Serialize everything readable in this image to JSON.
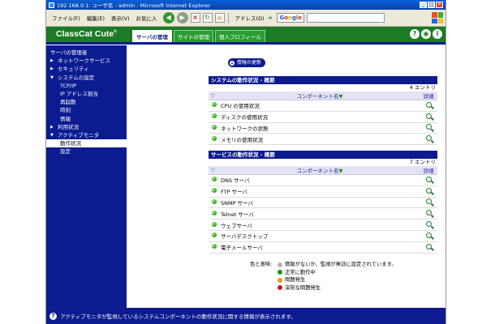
{
  "window": {
    "title": "192.168.0.1: ユーザ名 - admin - Microsoft Internet Explorer",
    "controls": [
      "minimize-icon",
      "maximize-icon",
      "close-icon"
    ]
  },
  "ie": {
    "menus": [
      "ファイル(F)",
      "編集(E)",
      "表示(V)",
      "お気に入"
    ],
    "address_label": "アドレス(D)",
    "search_brand": "Google",
    "search_value": ""
  },
  "header": {
    "logo": "ClassCat Cute",
    "logo_mark": "®",
    "tabs": [
      "サーバの管理",
      "サイトの管理",
      "個人プロフィール"
    ],
    "active_tab": 0,
    "icons": [
      "help-icon",
      "view-icon",
      "info-icon"
    ]
  },
  "sidebar": {
    "items": [
      {
        "label": "サーバの管理者",
        "level": 0,
        "arrow": false
      },
      {
        "label": "ネットワークサービス",
        "level": 0,
        "arrow": "right"
      },
      {
        "label": "セキュリティ",
        "level": 0,
        "arrow": "right"
      },
      {
        "label": "システムの設定",
        "level": 0,
        "arrow": "down"
      },
      {
        "label": "TCP/IP",
        "level": 1
      },
      {
        "label": "IP アドレス割当",
        "level": 1
      },
      {
        "label": "再起動",
        "level": 1
      },
      {
        "label": "時刻",
        "level": 1
      },
      {
        "label": "情報",
        "level": 1
      },
      {
        "label": "利用状況",
        "level": 0,
        "arrow": "right"
      },
      {
        "label": "アクティブモニタ",
        "level": 0,
        "arrow": "down"
      },
      {
        "label": "動作状況",
        "level": 1,
        "active": true
      },
      {
        "label": "設定",
        "level": 1
      }
    ]
  },
  "main": {
    "refresh_button": "情報の更新",
    "system_panel": {
      "title": "システムの動作状況 - 概要",
      "count": "4 エントリ",
      "col_component": "コンポーネント名",
      "col_detail": "詳細",
      "rows": [
        "CPU の使用状況",
        "ディスクの使用状況",
        "ネットワークの状態",
        "メモリの使用状況"
      ]
    },
    "service_panel": {
      "title": "サービスの動作状況 - 概要",
      "count": "7 エントリ",
      "col_component": "コンポーネント名",
      "col_detail": "詳細",
      "rows": [
        "DNS サーバ",
        "FTP サーバ",
        "SNMP サーバ",
        "Telnet サーバ",
        "ウェブサーバ",
        "サーバデスクトップ",
        "電子メールサーバ"
      ]
    },
    "legend": {
      "label": "色と意味:",
      "items": [
        {
          "text": "情報がないか、監視が無効に設定されています。",
          "color": "#b4b4b4"
        },
        {
          "text": "正常に動作中",
          "color": "#1d9a10"
        },
        {
          "text": "問題発生",
          "color": "#e8a000"
        },
        {
          "text": "深刻な問題発生",
          "color": "#cc1a1a"
        }
      ]
    }
  },
  "status": {
    "text": "アクティブモニタが監視しているシステムコンポーネントの動作状況に関する情報が表示されます。"
  },
  "colors": {
    "nav_blue": "#0c1b8f",
    "header_green": "#1d7a26",
    "ok_green": "#1d9a10"
  }
}
